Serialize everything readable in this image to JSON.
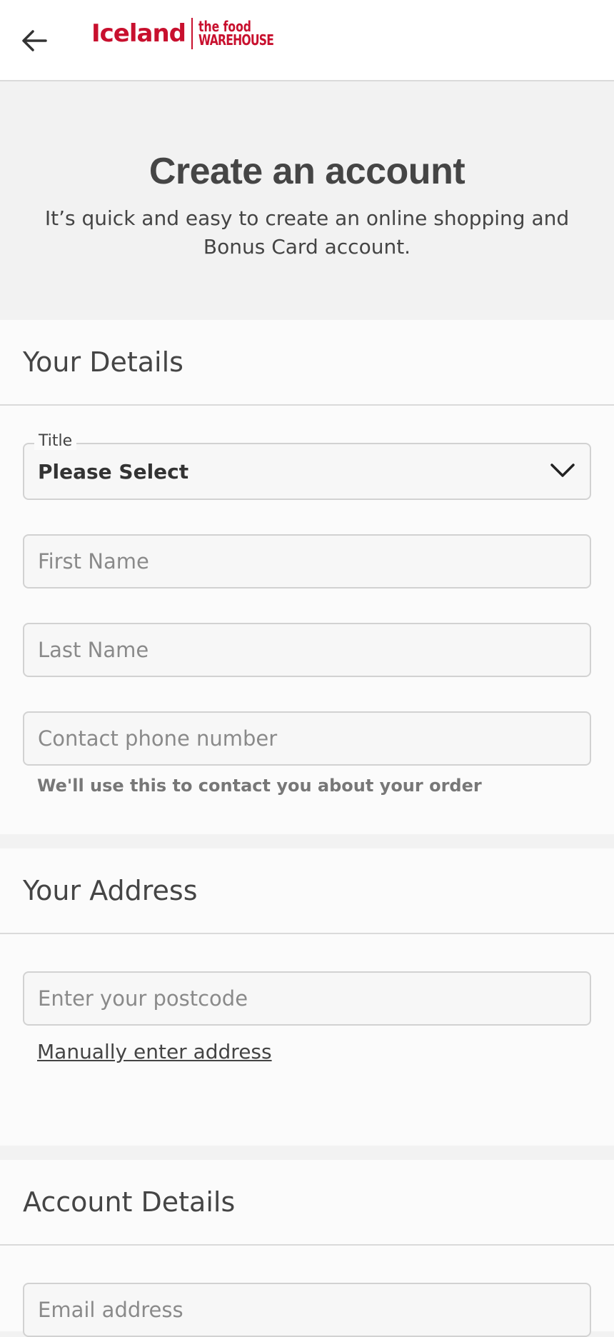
{
  "header": {
    "back_label": "back",
    "logo": {
      "main": "Iceland",
      "sub_line1": "the food",
      "sub_line2": "WAREHOUSE"
    }
  },
  "hero": {
    "title": "Create an account",
    "subtitle": "It’s quick and easy to create an online shopping and Bonus Card account."
  },
  "your_details": {
    "heading": "Your Details",
    "title_field": {
      "label": "Title",
      "value": "Please Select"
    },
    "first_name": {
      "placeholder": "First Name"
    },
    "last_name": {
      "placeholder": "Last Name"
    },
    "phone": {
      "placeholder": "Contact phone number",
      "hint": "We'll use this to contact you about your order"
    }
  },
  "your_address": {
    "heading": "Your Address",
    "postcode": {
      "placeholder": "Enter your postcode"
    },
    "manual_link": "Manually enter address"
  },
  "account_details": {
    "heading": "Account Details",
    "email": {
      "placeholder": "Email address"
    }
  },
  "colors": {
    "brand": "#c8102e",
    "page_bg": "#f2f2f2",
    "section_bg": "#fbfbfb",
    "text": "#444444"
  }
}
